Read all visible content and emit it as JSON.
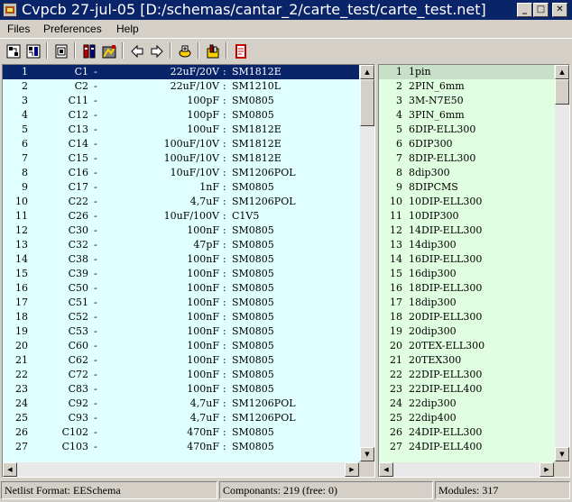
{
  "window": {
    "title": "Cvpcb 27-jul-05 [D:/schemas/cantar_2/carte_test/carte_test.net]",
    "min_glyph": "_",
    "max_glyph": "□",
    "close_glyph": "✕"
  },
  "menu": [
    "Files",
    "Preferences",
    "Help"
  ],
  "toolbar": {
    "buttons": [
      "load-netlist-icon",
      "save-netlist-icon",
      "create-component-file-icon",
      "library-config-icon",
      "view-footprint-icon",
      "previous-icon",
      "next-icon",
      "auto-associate-icon",
      "delete-associations-icon",
      "documentation-icon"
    ]
  },
  "components": [
    {
      "num": "1",
      "ref": "C1",
      "value": "22uF/20V",
      "footprint": "SM1812E"
    },
    {
      "num": "2",
      "ref": "C2",
      "value": "22uF/10V",
      "footprint": "SM1210L"
    },
    {
      "num": "3",
      "ref": "C11",
      "value": "100pF",
      "footprint": "SM0805"
    },
    {
      "num": "4",
      "ref": "C12",
      "value": "100pF",
      "footprint": "SM0805"
    },
    {
      "num": "5",
      "ref": "C13",
      "value": "100uF",
      "footprint": "SM1812E"
    },
    {
      "num": "6",
      "ref": "C14",
      "value": "100uF/10V",
      "footprint": "SM1812E"
    },
    {
      "num": "7",
      "ref": "C15",
      "value": "100uF/10V",
      "footprint": "SM1812E"
    },
    {
      "num": "8",
      "ref": "C16",
      "value": "10uF/10V",
      "footprint": "SM1206POL"
    },
    {
      "num": "9",
      "ref": "C17",
      "value": "1nF",
      "footprint": "SM0805"
    },
    {
      "num": "10",
      "ref": "C22",
      "value": "4,7uF",
      "footprint": "SM1206POL"
    },
    {
      "num": "11",
      "ref": "C26",
      "value": "10uF/100V",
      "footprint": "C1V5"
    },
    {
      "num": "12",
      "ref": "C30",
      "value": "100nF",
      "footprint": "SM0805"
    },
    {
      "num": "13",
      "ref": "C32",
      "value": "47pF",
      "footprint": "SM0805"
    },
    {
      "num": "14",
      "ref": "C38",
      "value": "100nF",
      "footprint": "SM0805"
    },
    {
      "num": "15",
      "ref": "C39",
      "value": "100nF",
      "footprint": "SM0805"
    },
    {
      "num": "16",
      "ref": "C50",
      "value": "100nF",
      "footprint": "SM0805"
    },
    {
      "num": "17",
      "ref": "C51",
      "value": "100nF",
      "footprint": "SM0805"
    },
    {
      "num": "18",
      "ref": "C52",
      "value": "100nF",
      "footprint": "SM0805"
    },
    {
      "num": "19",
      "ref": "C53",
      "value": "100nF",
      "footprint": "SM0805"
    },
    {
      "num": "20",
      "ref": "C60",
      "value": "100nF",
      "footprint": "SM0805"
    },
    {
      "num": "21",
      "ref": "C62",
      "value": "100nF",
      "footprint": "SM0805"
    },
    {
      "num": "22",
      "ref": "C72",
      "value": "100nF",
      "footprint": "SM0805"
    },
    {
      "num": "23",
      "ref": "C83",
      "value": "100nF",
      "footprint": "SM0805"
    },
    {
      "num": "24",
      "ref": "C92",
      "value": "4,7uF",
      "footprint": "SM1206POL"
    },
    {
      "num": "25",
      "ref": "C93",
      "value": "4,7uF",
      "footprint": "SM1206POL"
    },
    {
      "num": "26",
      "ref": "C102",
      "value": "470nF",
      "footprint": "SM0805"
    },
    {
      "num": "27",
      "ref": "C103",
      "value": "470nF",
      "footprint": "SM0805"
    }
  ],
  "modules": [
    {
      "num": "1",
      "name": "1pin"
    },
    {
      "num": "2",
      "name": "2PIN_6mm"
    },
    {
      "num": "3",
      "name": "3M-N7E50"
    },
    {
      "num": "4",
      "name": "3PIN_6mm"
    },
    {
      "num": "5",
      "name": "6DIP-ELL300"
    },
    {
      "num": "6",
      "name": "6DIP300"
    },
    {
      "num": "7",
      "name": "8DIP-ELL300"
    },
    {
      "num": "8",
      "name": "8dip300"
    },
    {
      "num": "9",
      "name": "8DIPCMS"
    },
    {
      "num": "10",
      "name": "10DIP-ELL300"
    },
    {
      "num": "11",
      "name": "10DIP300"
    },
    {
      "num": "12",
      "name": "14DIP-ELL300"
    },
    {
      "num": "13",
      "name": "14dip300"
    },
    {
      "num": "14",
      "name": "16DIP-ELL300"
    },
    {
      "num": "15",
      "name": "16dip300"
    },
    {
      "num": "16",
      "name": "18DIP-ELL300"
    },
    {
      "num": "17",
      "name": "18dip300"
    },
    {
      "num": "18",
      "name": "20DIP-ELL300"
    },
    {
      "num": "19",
      "name": "20dip300"
    },
    {
      "num": "20",
      "name": "20TEX-ELL300"
    },
    {
      "num": "21",
      "name": "20TEX300"
    },
    {
      "num": "22",
      "name": "22DIP-ELL300"
    },
    {
      "num": "23",
      "name": "22DIP-ELL400"
    },
    {
      "num": "24",
      "name": "22dip300"
    },
    {
      "num": "25",
      "name": "22dip400"
    },
    {
      "num": "26",
      "name": "24DIP-ELL300"
    },
    {
      "num": "27",
      "name": "24DIP-ELL400"
    }
  ],
  "status": {
    "netlist_format": "Netlist Format: EESchema",
    "components": "Componants: 219 (free: 0)",
    "modules": "Modules: 317"
  },
  "colors": {
    "titlebar": "#0a246a",
    "components_bg": "#e0ffff",
    "modules_bg": "#e0ffe0",
    "selection": "#0a246a"
  }
}
